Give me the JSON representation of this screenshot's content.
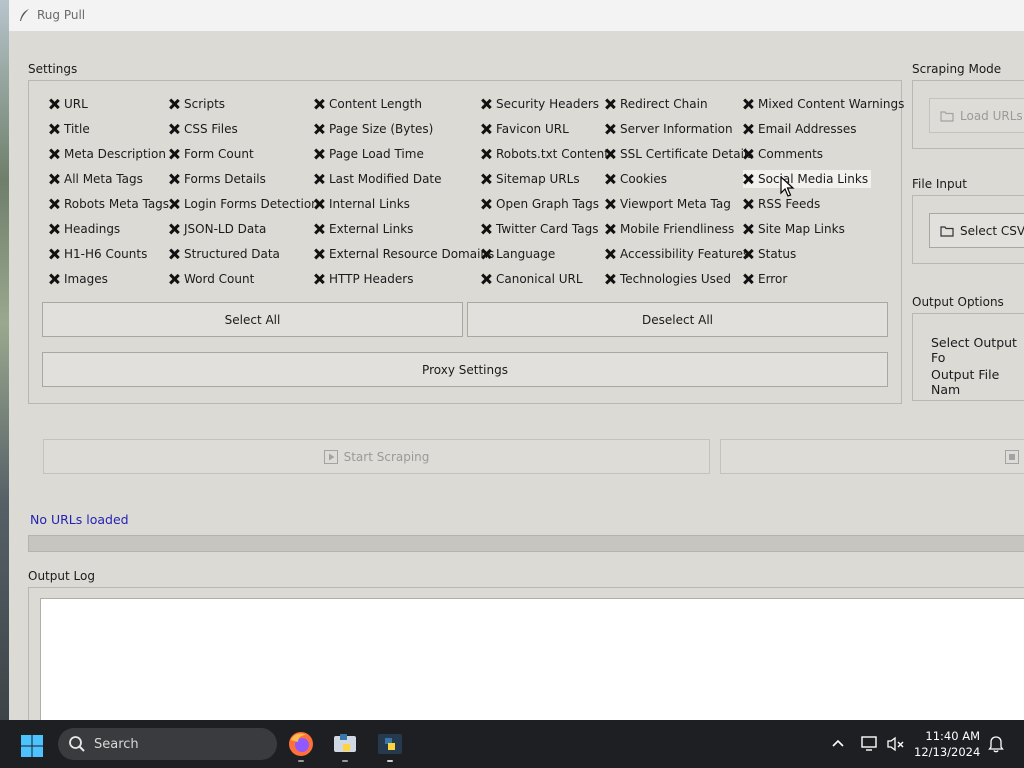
{
  "window": {
    "title": "Rug Pull"
  },
  "settings": {
    "label": "Settings",
    "columns": [
      [
        "URL",
        "Title",
        "Meta Description",
        "All Meta Tags",
        "Robots Meta Tags",
        "Headings",
        "H1-H6 Counts",
        "Images"
      ],
      [
        "Scripts",
        "CSS Files",
        "Form Count",
        "Forms Details",
        "Login Forms Detection",
        "JSON-LD Data",
        "Structured Data",
        "Word Count"
      ],
      [
        "Content Length",
        "Page Size (Bytes)",
        "Page Load Time",
        "Last Modified Date",
        "Internal Links",
        "External Links",
        "External Resource Domains",
        "HTTP Headers"
      ],
      [
        "Security Headers",
        "Favicon URL",
        "Robots.txt Content",
        "Sitemap URLs",
        "Open Graph Tags",
        "Twitter Card Tags",
        "Language",
        "Canonical URL"
      ],
      [
        "Redirect Chain",
        "Server Information",
        "SSL Certificate Details",
        "Cookies",
        "Viewport Meta Tag",
        "Mobile Friendliness",
        "Accessibility Features",
        "Technologies Used"
      ],
      [
        "Mixed Content Warnings",
        "Email Addresses",
        "Comments",
        "Social Media Links",
        "RSS Feeds",
        "Site Map Links",
        "Status",
        "Error"
      ]
    ],
    "all_checked": true,
    "select_all_label": "Select All",
    "deselect_all_label": "Deselect All",
    "proxy_label": "Proxy Settings"
  },
  "scraping_mode": {
    "label": "Scraping Mode",
    "load_urls_label": "Load URLs"
  },
  "file_input": {
    "label": "File Input",
    "select_csv_label": "Select CSV"
  },
  "output_options": {
    "label": "Output Options",
    "format_label": "Select Output Fo",
    "filename_label": "Output File Nam"
  },
  "actions": {
    "start_label": "Start Scraping"
  },
  "status": {
    "text": "No URLs loaded",
    "color": "#2323b4",
    "progress": 0
  },
  "output_log": {
    "label": "Output Log",
    "content": ""
  },
  "taskbar": {
    "search_label": "Search",
    "time": "11:40 AM",
    "date": "12/13/2024"
  },
  "colors": {
    "window_bg": "#dcdad5",
    "taskbar_bg": "#1e1f22",
    "accent": "#2323b4"
  }
}
